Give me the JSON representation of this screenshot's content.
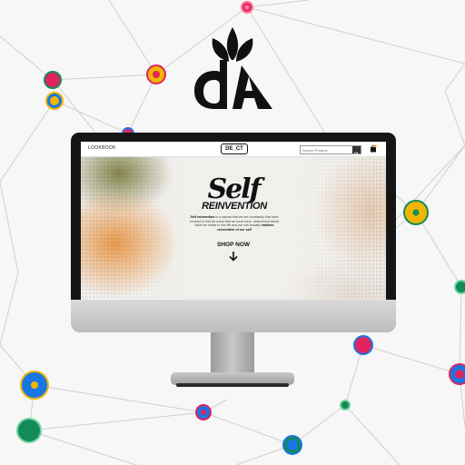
{
  "colors": {
    "background": "#f7f7f7",
    "network_line": "#cfcfcf",
    "node_red": "#e0245e",
    "node_blue": "#1877e4",
    "node_yellow": "#f2b600",
    "node_green": "#138a5a",
    "logo": "#111111"
  },
  "logo": {
    "icon": "leaf-sprout-monogram-icon"
  },
  "site": {
    "nav": {
      "lookbook": "LOOKBOOK"
    },
    "brand": "DE_CT",
    "search": {
      "placeholder": "Search Product"
    },
    "cart_icon": "shopping-bag-icon",
    "hero": {
      "headline_top": "Self",
      "headline_bottom": "REINVENTION",
      "body_lead": "Self reinvention",
      "body_text": "is a natural that we are constantly that have evolved to this far world that we must have, determined about what we chose in this life and we can actually ",
      "body_emphasis": "endless reinvention of our self",
      "cta_label": "SHOP NOW",
      "cta_icon": "arrow-down-icon"
    }
  }
}
